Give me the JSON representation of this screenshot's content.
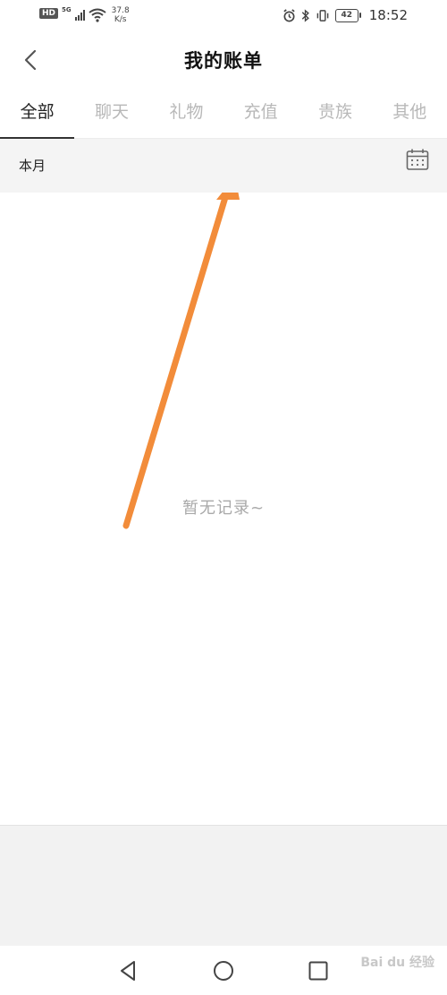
{
  "status": {
    "hd": "HD",
    "network": "5G",
    "speed_value": "37.8",
    "speed_unit": "K/s",
    "battery": "42",
    "time": "18:52"
  },
  "header": {
    "title": "我的账单"
  },
  "tabs": [
    {
      "label": "全部",
      "active": true
    },
    {
      "label": "聊天",
      "active": false
    },
    {
      "label": "礼物",
      "active": false
    },
    {
      "label": "充值",
      "active": false
    },
    {
      "label": "贵族",
      "active": false
    },
    {
      "label": "其他",
      "active": false
    }
  ],
  "filter": {
    "month_label": "本月"
  },
  "content": {
    "empty_text": "暂无记录~",
    "annotation_color": "#f28c3a"
  },
  "watermark": {
    "text": "Bai du 经验"
  }
}
